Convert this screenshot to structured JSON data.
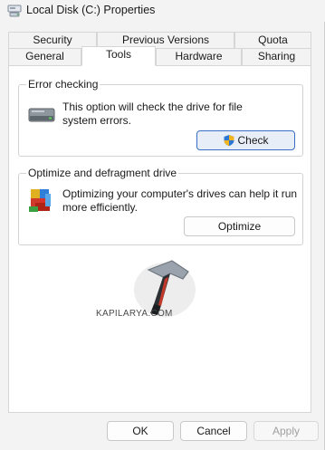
{
  "window": {
    "title": "Local Disk (C:) Properties"
  },
  "tabs": {
    "row1": [
      "Security",
      "Previous Versions",
      "Quota"
    ],
    "row2": [
      "General",
      "Tools",
      "Hardware",
      "Sharing"
    ],
    "active": "Tools"
  },
  "error_checking": {
    "title": "Error checking",
    "line1": "This option will check the drive for file",
    "line2": "system errors.",
    "button_label": "Check"
  },
  "optimize": {
    "title": "Optimize and defragment drive",
    "line1": "Optimizing your computer's drives can help it run",
    "line2": "more efficiently.",
    "button_label": "Optimize"
  },
  "watermark": {
    "text": "KAPILARYA.COM"
  },
  "footer": {
    "ok_label": "OK",
    "cancel_label": "Cancel",
    "apply_label": "Apply"
  },
  "colors": {
    "accent": "#3b6fc5",
    "disabled_text": "#a0a0a0"
  },
  "icons": {
    "title": "drive-properties-icon",
    "drive": "hard-drive-icon",
    "shield": "uac-shield-icon",
    "defrag": "defrag-icon",
    "watermark": "hammer-logo-icon"
  }
}
